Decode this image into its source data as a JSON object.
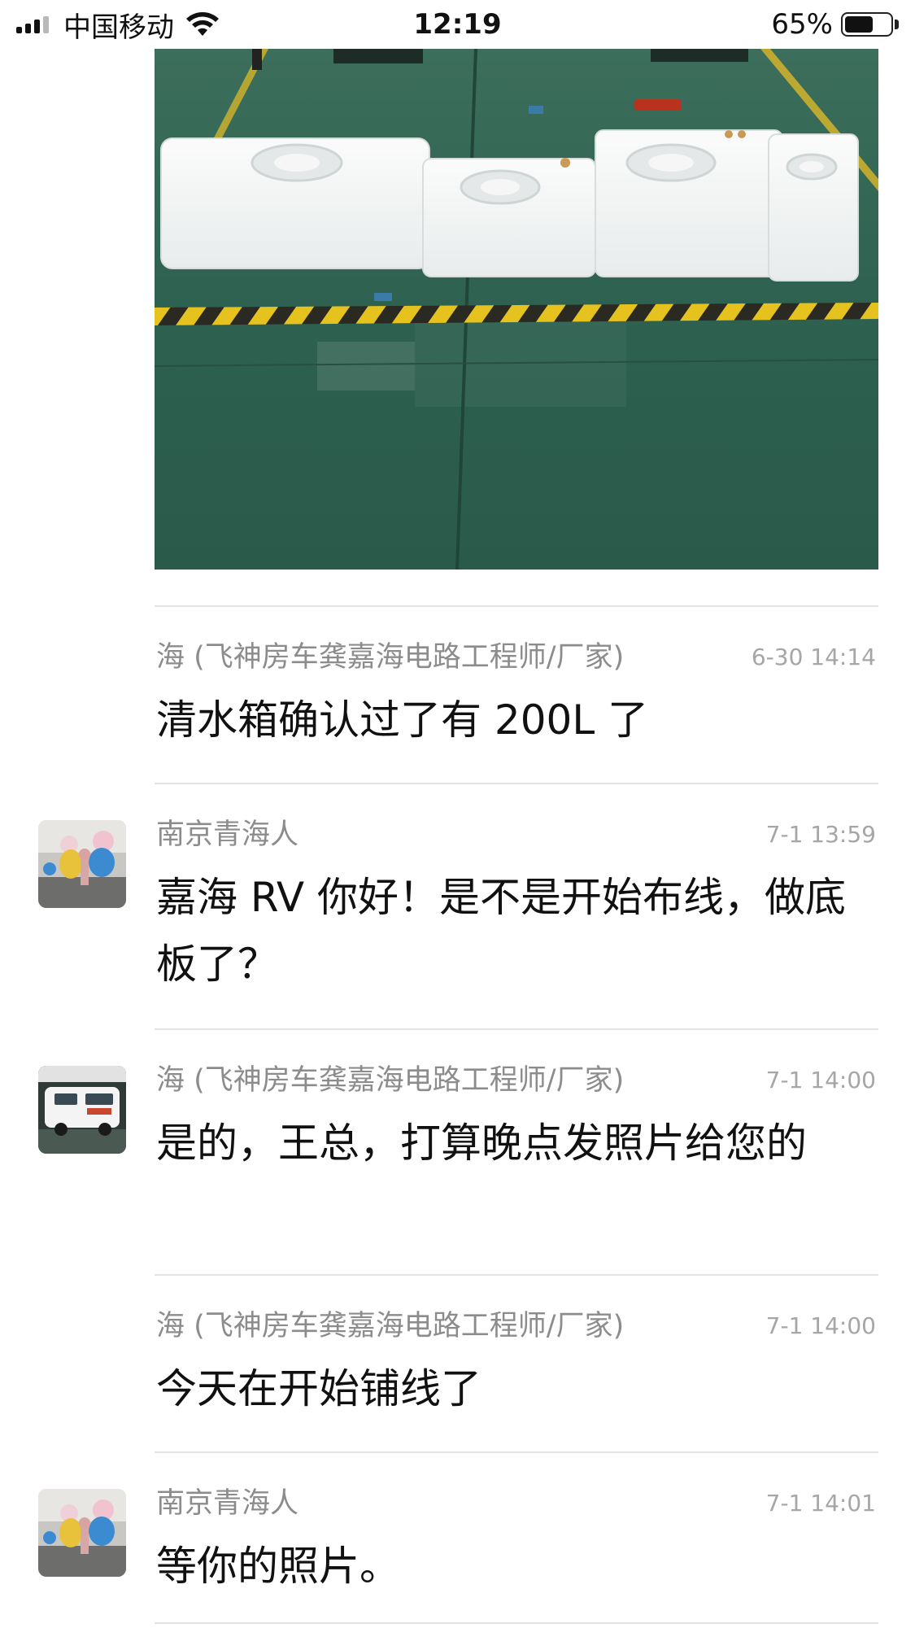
{
  "status_bar": {
    "carrier": "中国移动",
    "time": "12:19",
    "battery_percent_text": "65%",
    "battery_level": 0.65,
    "signal_bars_active": 3,
    "signal_bars_total": 4
  },
  "photo": {
    "icon": "image-photo-water-tanks"
  },
  "messages": [
    {
      "sender": "海 (飞神房车龚嘉海电路工程师/厂家)",
      "time": "6-30 14:14",
      "text": "清水箱确认过了有 200L 了",
      "avatar": "none"
    },
    {
      "sender": "南京青海人",
      "time": "7-1 13:59",
      "text": "嘉海 RV 你好！是不是开始布线，做底板了？",
      "avatar": "photo-people-cartoon-statues"
    },
    {
      "sender": "海 (飞神房车龚嘉海电路工程师/厂家)",
      "time": "7-1 14:00",
      "text": "是的，王总，打算晚点发照片给您的",
      "avatar": "photo-white-rv"
    },
    {
      "sender": "海 (飞神房车龚嘉海电路工程师/厂家)",
      "time": "7-1 14:00",
      "text": "今天在开始铺线了",
      "avatar": "none"
    },
    {
      "sender": "南京青海人",
      "time": "7-1 14:01",
      "text": "等你的照片。",
      "avatar": "photo-people-cartoon-statues"
    }
  ],
  "colors": {
    "sender_text": "#8c8c8c",
    "time_text": "#a6a6a6",
    "message_text": "#111111",
    "divider": "#e3e3e3",
    "floor_green": "#2f6652"
  }
}
